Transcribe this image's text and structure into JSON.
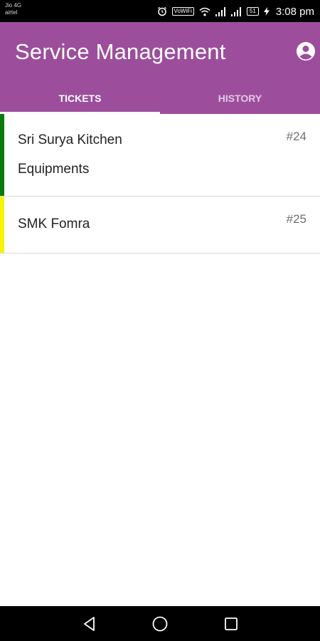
{
  "status_bar": {
    "carrier_1": "Jio 4G",
    "carrier_2": "airtel",
    "vowifi": "VoWiFi",
    "battery": "51",
    "time": "3:08 pm"
  },
  "app_bar": {
    "title": "Service Management",
    "account_icon": "account-circle-icon",
    "background": "#9c4e9c"
  },
  "tabs": [
    {
      "label": "TICKETS",
      "active": true
    },
    {
      "label": "HISTORY",
      "active": false
    }
  ],
  "tickets": [
    {
      "name": "Sri Surya Kitchen Equipments",
      "number": "#24",
      "status_color": "#0a7a0a"
    },
    {
      "name": "SMK Fomra",
      "number": "#25",
      "status_color": "#f5f500"
    }
  ],
  "nav_bar": {
    "back_icon": "back-triangle-icon",
    "home_icon": "home-circle-icon",
    "recents_icon": "recents-square-icon"
  }
}
